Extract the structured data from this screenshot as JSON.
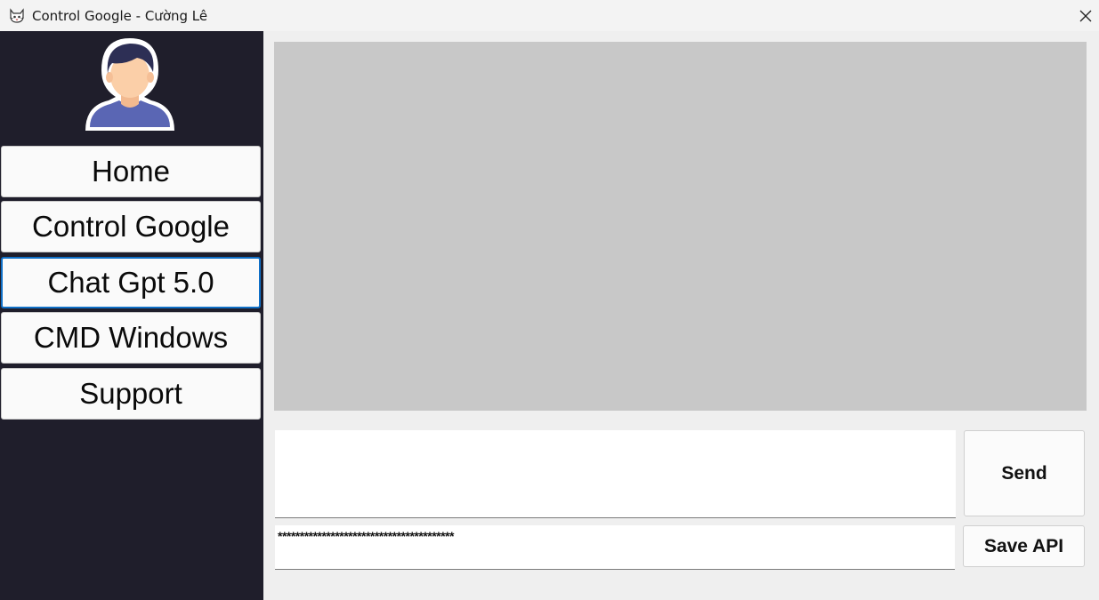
{
  "window": {
    "title": "Control Google - Cường Lê",
    "app_icon": "cat-face-icon",
    "close_icon": "close-icon"
  },
  "sidebar": {
    "avatar_icon": "user-avatar-icon",
    "items": [
      {
        "label": "Home",
        "active": false
      },
      {
        "label": "Control Google",
        "active": false
      },
      {
        "label": "Chat Gpt 5.0",
        "active": true
      },
      {
        "label": "CMD Windows",
        "active": false
      },
      {
        "label": "Support",
        "active": false
      }
    ]
  },
  "chat": {
    "message_value": "",
    "api_key_masked": "****************************************",
    "send_label": "Send",
    "save_api_label": "Save API"
  },
  "colors": {
    "sidebar_bg": "#1f1e2b",
    "display_bg": "#c8c8c8",
    "active_border": "#0f6fc6",
    "avatar_shirt": "#5a66b4",
    "avatar_hair": "#2d2f55",
    "avatar_skin": "#fbcfa8"
  }
}
